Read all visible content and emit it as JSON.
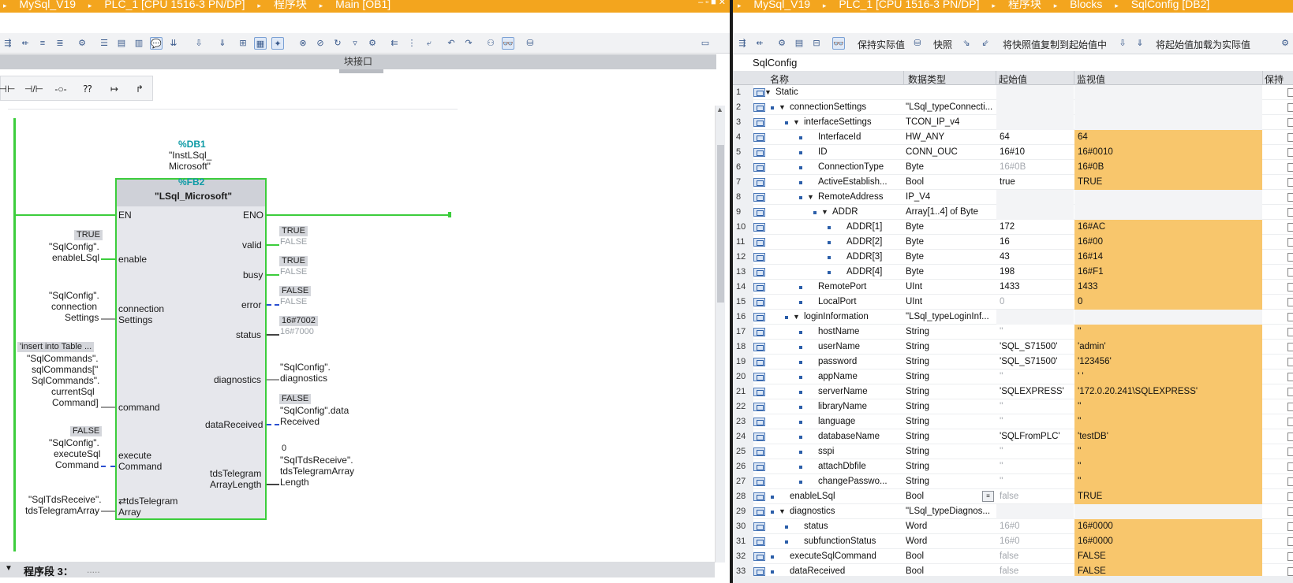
{
  "left": {
    "title_segments": [
      "MySql_V19",
      "PLC_1 [CPU 1516-3 PN/DP]",
      "程序块",
      "Main [OB1]"
    ],
    "interface_label": "块接口",
    "ladder_buttons": [
      "⊣⊢",
      "⊣/⊢",
      "-○-",
      "⁇",
      "↦",
      "↱"
    ],
    "block": {
      "db_addr": "%DB1",
      "db_name_line1": "\"InstLSql_",
      "db_name_line2": "Microsoft\"",
      "fb_addr": "%FB2",
      "fb_name": "\"LSql_Microsoft\"",
      "en": "EN",
      "eno": "ENO",
      "inputs": [
        {
          "pin": "enable",
          "value": "TRUE",
          "operand": [
            "\"SqlConfig\".",
            "enableLSql"
          ]
        },
        {
          "pin": "connection",
          "pin2": "Settings",
          "operand": [
            "\"SqlConfig\".",
            "connection",
            "Settings"
          ]
        },
        {
          "pin": "command",
          "value": "'insert into Table ...",
          "operand": [
            "\"SqlCommands\".",
            "sqlCommands[\"",
            "SqlCommands\".",
            "currentSql",
            "Command]"
          ]
        },
        {
          "pin": "execute",
          "pin2": "Command",
          "value": "FALSE",
          "operand": [
            "\"SqlConfig\".",
            "executeSql",
            "Command"
          ]
        },
        {
          "pin": "⇄tdsTelegram",
          "pin2": "Array",
          "operand": [
            "\"SqlTdsReceive\".",
            "tdsTelegramArray"
          ]
        }
      ],
      "outputs": [
        {
          "pin": "valid",
          "value": "TRUE",
          "value2": "FALSE"
        },
        {
          "pin": "busy",
          "value": "TRUE",
          "value2": "FALSE"
        },
        {
          "pin": "error",
          "value": "FALSE",
          "value2": "FALSE"
        },
        {
          "pin": "status",
          "value": "16#7002",
          "value2": "16#7000"
        },
        {
          "pin": "diagnostics",
          "operand": [
            "\"SqlConfig\".",
            "diagnostics"
          ]
        },
        {
          "pin": "dataReceived",
          "value": "FALSE",
          "operand": [
            "\"SqlConfig\".data",
            "Received"
          ]
        },
        {
          "pin": "tdsTelegram",
          "pin2": "ArrayLength",
          "value": "0",
          "operand": [
            "\"SqlTdsReceive\".",
            "tdsTelegramArray",
            "Length"
          ]
        }
      ]
    },
    "section_label": "程序段 3：",
    "section_dots": "....."
  },
  "right": {
    "title_segments": [
      "MySql_V19",
      "PLC_1 [CPU 1516-3 PN/DP]",
      "程序块",
      "Blocks",
      "SqlConfig [DB2]"
    ],
    "toolbar": {
      "keep_actual": "保持实际值",
      "snapshot": "快照",
      "copy_snapshot": "将快照值复制到起始值中",
      "load_start": "将起始值加载为实际值"
    },
    "db_title": "SqlConfig",
    "headers": {
      "name": "名称",
      "type": "数据类型",
      "start": "起始值",
      "monitor": "监视值",
      "retain": "保持"
    },
    "rows": [
      {
        "n": "1",
        "level": 0,
        "tri": "▼",
        "name": "Static",
        "type": "",
        "start": "",
        "mon": "",
        "hl": false
      },
      {
        "n": "2",
        "level": 1,
        "tri": "▼",
        "name": "connectionSettings",
        "type": "\"LSql_typeConnecti...",
        "start": "",
        "mon": "",
        "hl": false
      },
      {
        "n": "3",
        "level": 2,
        "tri": "▼",
        "name": "interfaceSettings",
        "type": "TCON_IP_v4",
        "start": "",
        "mon": "",
        "hl": false
      },
      {
        "n": "4",
        "level": 3,
        "tri": "",
        "name": "InterfaceId",
        "type": "HW_ANY",
        "start": "64",
        "mon": "64",
        "hl": true
      },
      {
        "n": "5",
        "level": 3,
        "tri": "",
        "name": "ID",
        "type": "CONN_OUC",
        "start": "16#10",
        "mon": "16#0010",
        "hl": true
      },
      {
        "n": "6",
        "level": 3,
        "tri": "",
        "name": "ConnectionType",
        "type": "Byte",
        "start": "16#0B",
        "mon": "16#0B",
        "hl": true,
        "g": true
      },
      {
        "n": "7",
        "level": 3,
        "tri": "",
        "name": "ActiveEstablish...",
        "type": "Bool",
        "start": "true",
        "mon": "TRUE",
        "hl": true
      },
      {
        "n": "8",
        "level": 3,
        "tri": "▼",
        "name": "RemoteAddress",
        "type": "IP_V4",
        "start": "",
        "mon": "",
        "hl": false
      },
      {
        "n": "9",
        "level": 4,
        "tri": "▼",
        "name": "ADDR",
        "type": "Array[1..4] of Byte",
        "start": "",
        "mon": "",
        "hl": false
      },
      {
        "n": "10",
        "level": 5,
        "tri": "",
        "name": "ADDR[1]",
        "type": "Byte",
        "start": "172",
        "mon": "16#AC",
        "hl": true
      },
      {
        "n": "11",
        "level": 5,
        "tri": "",
        "name": "ADDR[2]",
        "type": "Byte",
        "start": "16",
        "mon": "16#00",
        "hl": true
      },
      {
        "n": "12",
        "level": 5,
        "tri": "",
        "name": "ADDR[3]",
        "type": "Byte",
        "start": "43",
        "mon": "16#14",
        "hl": true
      },
      {
        "n": "13",
        "level": 5,
        "tri": "",
        "name": "ADDR[4]",
        "type": "Byte",
        "start": "198",
        "mon": "16#F1",
        "hl": true
      },
      {
        "n": "14",
        "level": 3,
        "tri": "",
        "name": "RemotePort",
        "type": "UInt",
        "start": "1433",
        "mon": "1433",
        "hl": true
      },
      {
        "n": "15",
        "level": 3,
        "tri": "",
        "name": "LocalPort",
        "type": "UInt",
        "start": "0",
        "mon": "0",
        "hl": true,
        "g": true
      },
      {
        "n": "16",
        "level": 2,
        "tri": "▼",
        "name": "loginInformation",
        "type": "\"LSql_typeLoginInf...",
        "start": "",
        "mon": "",
        "hl": false
      },
      {
        "n": "17",
        "level": 3,
        "tri": "",
        "name": "hostName",
        "type": "String",
        "start": "''",
        "mon": "''",
        "hl": true,
        "g": true
      },
      {
        "n": "18",
        "level": 3,
        "tri": "",
        "name": "userName",
        "type": "String",
        "start": "'SQL_S71500'",
        "mon": "'admin'",
        "hl": true
      },
      {
        "n": "19",
        "level": 3,
        "tri": "",
        "name": "password",
        "type": "String",
        "start": "'SQL_S71500'",
        "mon": "'123456'",
        "hl": true
      },
      {
        "n": "20",
        "level": 3,
        "tri": "",
        "name": "appName",
        "type": "String",
        "start": "''",
        "mon": "' '",
        "hl": true,
        "g": true
      },
      {
        "n": "21",
        "level": 3,
        "tri": "",
        "name": "serverName",
        "type": "String",
        "start": "'SQLEXPRESS'",
        "mon": "'172.0.20.241\\SQLEXPRESS'",
        "hl": true
      },
      {
        "n": "22",
        "level": 3,
        "tri": "",
        "name": "libraryName",
        "type": "String",
        "start": "''",
        "mon": "''",
        "hl": true,
        "g": true
      },
      {
        "n": "23",
        "level": 3,
        "tri": "",
        "name": "language",
        "type": "String",
        "start": "''",
        "mon": "''",
        "hl": true,
        "g": true
      },
      {
        "n": "24",
        "level": 3,
        "tri": "",
        "name": "databaseName",
        "type": "String",
        "start": "'SQLFromPLC'",
        "mon": "'testDB'",
        "hl": true
      },
      {
        "n": "25",
        "level": 3,
        "tri": "",
        "name": "sspi",
        "type": "String",
        "start": "''",
        "mon": "''",
        "hl": true,
        "g": true
      },
      {
        "n": "26",
        "level": 3,
        "tri": "",
        "name": "attachDbfile",
        "type": "String",
        "start": "''",
        "mon": "''",
        "hl": true,
        "g": true
      },
      {
        "n": "27",
        "level": 3,
        "tri": "",
        "name": "changePasswo...",
        "type": "String",
        "start": "''",
        "mon": "''",
        "hl": true,
        "g": true
      },
      {
        "n": "28",
        "level": 1,
        "tri": "",
        "name": "enableLSql",
        "type": "Bool",
        "start": "false",
        "mon": "TRUE",
        "hl": true,
        "g": true,
        "btn": true
      },
      {
        "n": "29",
        "level": 1,
        "tri": "▼",
        "name": "diagnostics",
        "type": "\"LSql_typeDiagnos...",
        "start": "",
        "mon": "",
        "hl": false
      },
      {
        "n": "30",
        "level": 2,
        "tri": "",
        "name": "status",
        "type": "Word",
        "start": "16#0",
        "mon": "16#0000",
        "hl": true,
        "g": true
      },
      {
        "n": "31",
        "level": 2,
        "tri": "",
        "name": "subfunctionStatus",
        "type": "Word",
        "start": "16#0",
        "mon": "16#0000",
        "hl": true,
        "g": true
      },
      {
        "n": "32",
        "level": 1,
        "tri": "",
        "name": "executeSqlCommand",
        "type": "Bool",
        "start": "false",
        "mon": "FALSE",
        "hl": true,
        "g": true
      },
      {
        "n": "33",
        "level": 1,
        "tri": "",
        "name": "dataReceived",
        "type": "Bool",
        "start": "false",
        "mon": "FALSE",
        "hl": true,
        "g": true
      }
    ]
  },
  "colors": {
    "titlebar": "#f3a51e",
    "power_flow": "#3ccd3c",
    "monitor_highlight": "#f8c66c",
    "teal_addr": "#0c9aa5"
  }
}
